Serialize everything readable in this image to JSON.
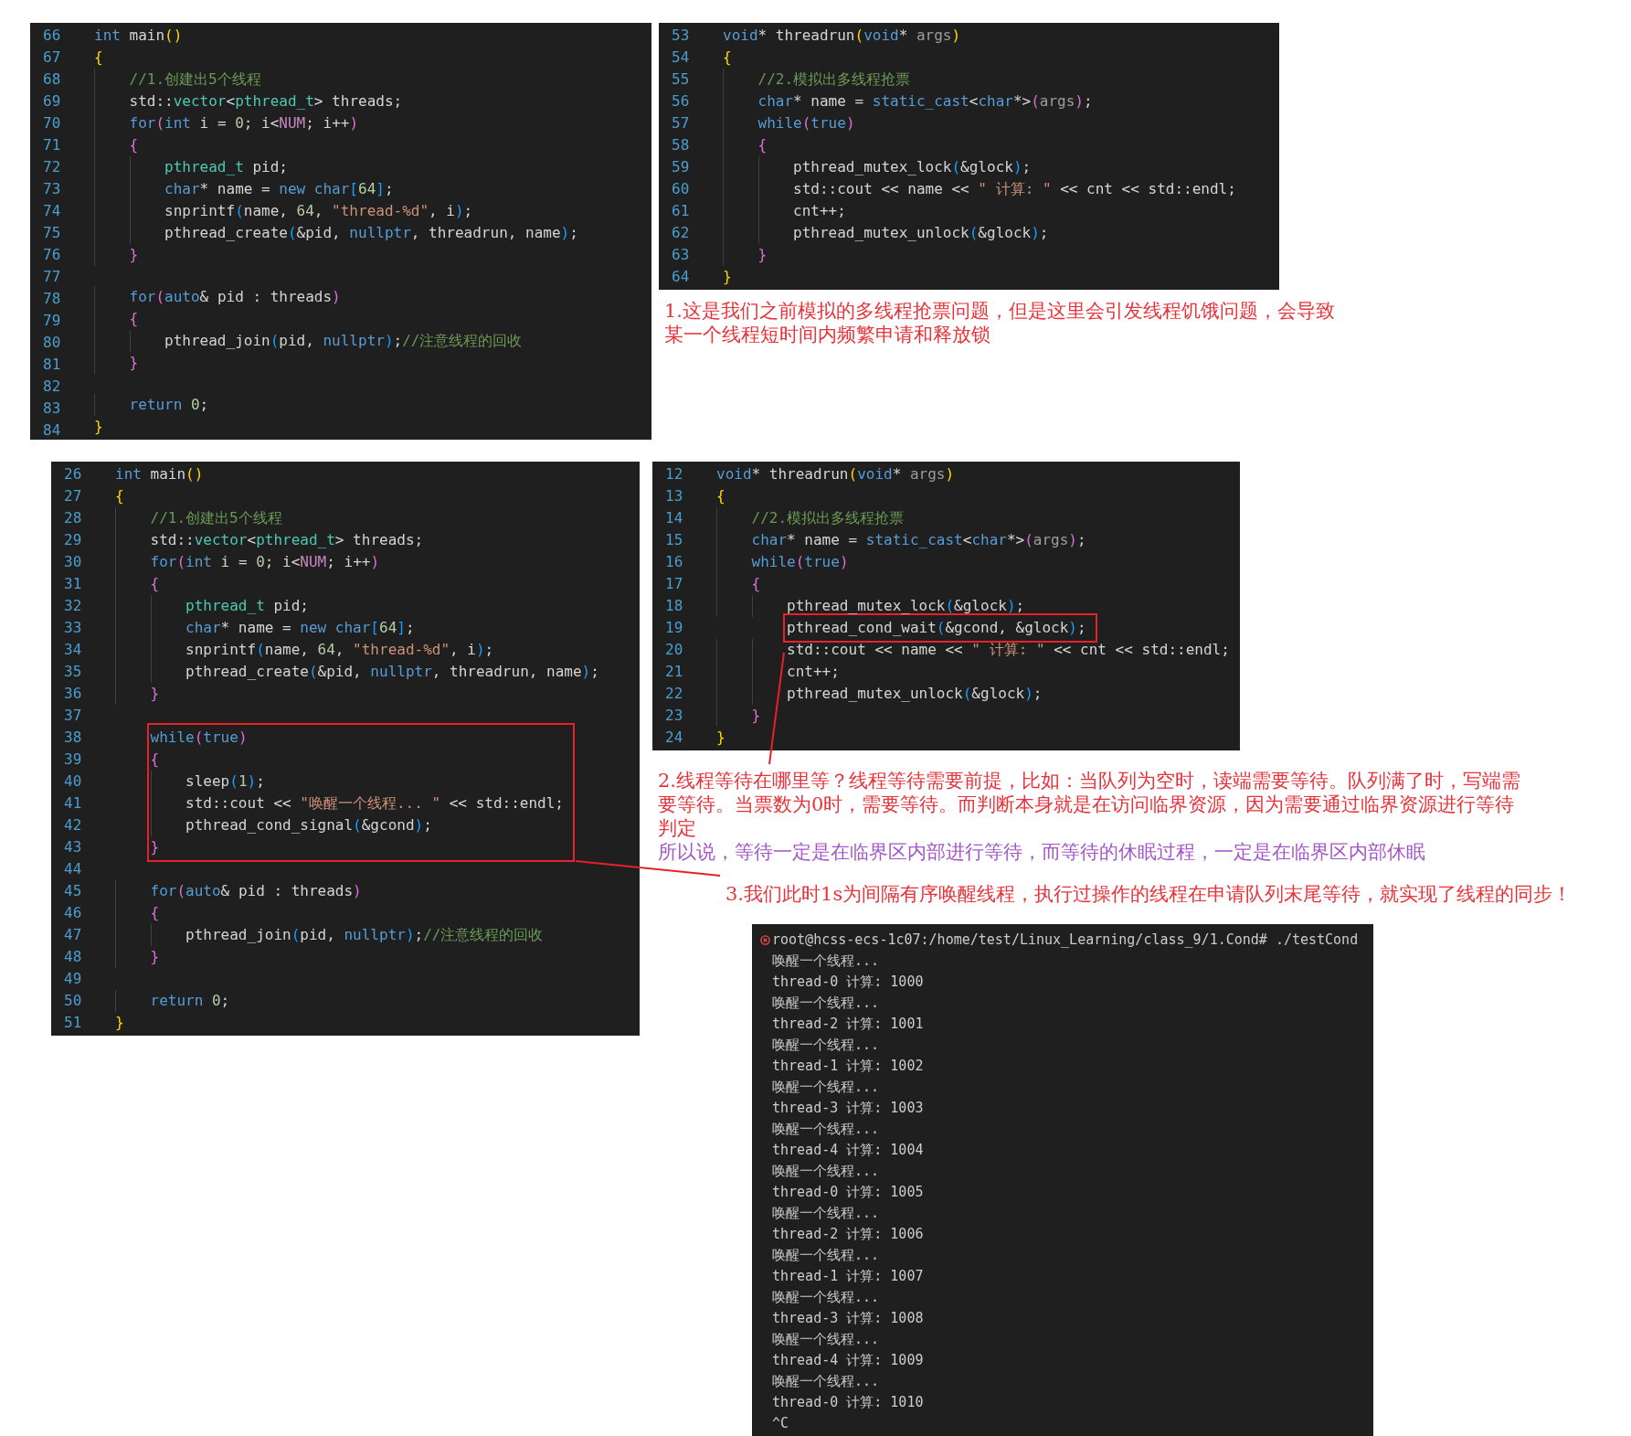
{
  "code_panels": [
    {
      "lines": [
        {
          "kind": "line",
          "number": "66",
          "tokens": [
            {
              "kind": "kw",
              "text": "int"
            },
            {
              "kind": "txt",
              "text": " main"
            },
            {
              "kind": "b1",
              "text": "()"
            }
          ]
        },
        {
          "kind": "line",
          "number": "67",
          "tokens": [
            {
              "kind": "b1",
              "text": "{"
            }
          ]
        },
        {
          "kind": "line",
          "number": "68",
          "tokens": [
            {
              "kind": "com",
              "text": "    //1.创建出5个线程"
            }
          ]
        },
        {
          "kind": "line",
          "number": "69",
          "tokens": [
            {
              "kind": "txt",
              "text": "    std::"
            },
            {
              "kind": "type",
              "text": "vector"
            },
            {
              "kind": "txt",
              "text": "<"
            },
            {
              "kind": "type",
              "text": "pthread_t"
            },
            {
              "kind": "txt",
              "text": "> threads;"
            }
          ]
        },
        {
          "kind": "line",
          "number": "70",
          "tokens": [
            {
              "kind": "kw",
              "text": "    for"
            },
            {
              "kind": "b2",
              "text": "("
            },
            {
              "kind": "kw",
              "text": "int"
            },
            {
              "kind": "txt",
              "text": " i = "
            },
            {
              "kind": "num",
              "text": "0"
            },
            {
              "kind": "txt",
              "text": "; i<"
            },
            {
              "kind": "mac",
              "text": "NUM"
            },
            {
              "kind": "txt",
              "text": "; i++"
            },
            {
              "kind": "b2",
              "text": ")"
            }
          ]
        },
        {
          "kind": "line",
          "number": "71",
          "tokens": [
            {
              "kind": "b2",
              "text": "    {"
            }
          ]
        },
        {
          "kind": "line",
          "number": "72",
          "tokens": [
            {
              "kind": "type",
              "text": "        pthread_t"
            },
            {
              "kind": "txt",
              "text": " pid;"
            }
          ]
        },
        {
          "kind": "line",
          "number": "73",
          "tokens": [
            {
              "kind": "kw",
              "text": "        char"
            },
            {
              "kind": "txt",
              "text": "* name = "
            },
            {
              "kind": "kw",
              "text": "new char"
            },
            {
              "kind": "b3",
              "text": "["
            },
            {
              "kind": "num",
              "text": "64"
            },
            {
              "kind": "b3",
              "text": "]"
            },
            {
              "kind": "txt",
              "text": ";"
            }
          ]
        },
        {
          "kind": "line",
          "number": "74",
          "tokens": [
            {
              "kind": "txt",
              "text": "        snprintf"
            },
            {
              "kind": "b3",
              "text": "("
            },
            {
              "kind": "txt",
              "text": "name, "
            },
            {
              "kind": "num",
              "text": "64"
            },
            {
              "kind": "txt",
              "text": ", "
            },
            {
              "kind": "str",
              "text": "\"thread-%d\""
            },
            {
              "kind": "txt",
              "text": ", i"
            },
            {
              "kind": "b3",
              "text": ")"
            },
            {
              "kind": "txt",
              "text": ";"
            }
          ]
        },
        {
          "kind": "line",
          "number": "75",
          "tokens": [
            {
              "kind": "txt",
              "text": "        pthread_create"
            },
            {
              "kind": "b3",
              "text": "("
            },
            {
              "kind": "txt",
              "text": "&pid, "
            },
            {
              "kind": "kw",
              "text": "nullptr"
            },
            {
              "kind": "txt",
              "text": ", threadrun, name"
            },
            {
              "kind": "b3",
              "text": ")"
            },
            {
              "kind": "txt",
              "text": ";"
            }
          ]
        },
        {
          "kind": "line",
          "number": "76",
          "tokens": [
            {
              "kind": "b2",
              "text": "    }"
            }
          ]
        },
        {
          "kind": "line",
          "number": "77"
        },
        {
          "kind": "line",
          "number": "78",
          "tokens": [
            {
              "kind": "kw",
              "text": "    for"
            },
            {
              "kind": "b2",
              "text": "("
            },
            {
              "kind": "kw",
              "text": "auto"
            },
            {
              "kind": "txt",
              "text": "& pid : threads"
            },
            {
              "kind": "b2",
              "text": ")"
            }
          ]
        },
        {
          "kind": "line",
          "number": "79",
          "tokens": [
            {
              "kind": "b2",
              "text": "    {"
            }
          ]
        },
        {
          "kind": "line",
          "number": "80",
          "tokens": [
            {
              "kind": "txt",
              "text": "        pthread_join"
            },
            {
              "kind": "b3",
              "text": "("
            },
            {
              "kind": "txt",
              "text": "pid, "
            },
            {
              "kind": "kw",
              "text": "nullptr"
            },
            {
              "kind": "b3",
              "text": ")"
            },
            {
              "kind": "txt",
              "text": ";"
            },
            {
              "kind": "com",
              "text": "//注意线程的回收"
            }
          ]
        },
        {
          "kind": "line",
          "number": "81",
          "tokens": [
            {
              "kind": "b2",
              "text": "    }"
            }
          ]
        },
        {
          "kind": "line",
          "number": "82"
        },
        {
          "kind": "line",
          "number": "83",
          "tokens": [
            {
              "kind": "kw",
              "text": "    return"
            },
            {
              "kind": "num",
              "text": " 0"
            },
            {
              "kind": "txt",
              "text": ";"
            }
          ]
        },
        {
          "kind": "line",
          "number": "84",
          "tokens": [
            {
              "kind": "b1",
              "text": "}"
            }
          ]
        }
      ]
    },
    {
      "lines": [
        {
          "kind": "line",
          "number": "53",
          "tokens": [
            {
              "kind": "kw",
              "text": "void"
            },
            {
              "kind": "txt",
              "text": "* threadrun"
            },
            {
              "kind": "b1",
              "text": "("
            },
            {
              "kind": "kw",
              "text": "void"
            },
            {
              "kind": "txt",
              "text": "* "
            },
            {
              "kind": "par",
              "text": "args"
            },
            {
              "kind": "b1",
              "text": ")"
            }
          ]
        },
        {
          "kind": "line",
          "number": "54",
          "tokens": [
            {
              "kind": "b1",
              "text": "{"
            }
          ]
        },
        {
          "kind": "line",
          "number": "55",
          "tokens": [
            {
              "kind": "com",
              "text": "    //2.模拟出多线程抢票"
            }
          ]
        },
        {
          "kind": "line",
          "number": "56",
          "tokens": [
            {
              "kind": "kw",
              "text": "    char"
            },
            {
              "kind": "txt",
              "text": "* name = "
            },
            {
              "kind": "kw",
              "text": "static_cast"
            },
            {
              "kind": "txt",
              "text": "<"
            },
            {
              "kind": "kw",
              "text": "char"
            },
            {
              "kind": "txt",
              "text": "*>"
            },
            {
              "kind": "b2",
              "text": "("
            },
            {
              "kind": "par",
              "text": "args"
            },
            {
              "kind": "b2",
              "text": ")"
            },
            {
              "kind": "txt",
              "text": ";"
            }
          ]
        },
        {
          "kind": "line",
          "number": "57",
          "tokens": [
            {
              "kind": "kw",
              "text": "    while"
            },
            {
              "kind": "b2",
              "text": "("
            },
            {
              "kind": "kw",
              "text": "true"
            },
            {
              "kind": "b2",
              "text": ")"
            }
          ]
        },
        {
          "kind": "line",
          "number": "58",
          "tokens": [
            {
              "kind": "b2",
              "text": "    {"
            }
          ]
        },
        {
          "kind": "line",
          "number": "59",
          "tokens": [
            {
              "kind": "txt",
              "text": "        pthread_mutex_lock"
            },
            {
              "kind": "b3",
              "text": "("
            },
            {
              "kind": "txt",
              "text": "&glock"
            },
            {
              "kind": "b3",
              "text": ")"
            },
            {
              "kind": "txt",
              "text": ";"
            }
          ]
        },
        {
          "kind": "line",
          "number": "60",
          "tokens": [
            {
              "kind": "txt",
              "text": "        std::cout << name << "
            },
            {
              "kind": "str",
              "text": "\" 计算: \""
            },
            {
              "kind": "txt",
              "text": " << cnt << std::endl;"
            }
          ]
        },
        {
          "kind": "line",
          "number": "61",
          "tokens": [
            {
              "kind": "txt",
              "text": "        cnt++;"
            }
          ]
        },
        {
          "kind": "line",
          "number": "62",
          "tokens": [
            {
              "kind": "txt",
              "text": "        pthread_mutex_unlock"
            },
            {
              "kind": "b3",
              "text": "("
            },
            {
              "kind": "txt",
              "text": "&glock"
            },
            {
              "kind": "b3",
              "text": ")"
            },
            {
              "kind": "txt",
              "text": ";"
            }
          ]
        },
        {
          "kind": "line",
          "number": "63",
          "tokens": [
            {
              "kind": "b2",
              "text": "    }"
            }
          ]
        },
        {
          "kind": "line",
          "number": "64",
          "tokens": [
            {
              "kind": "b1",
              "text": "}"
            }
          ]
        }
      ]
    },
    {
      "lines": [
        {
          "kind": "line",
          "number": "26",
          "tokens": [
            {
              "kind": "kw",
              "text": "int"
            },
            {
              "kind": "txt",
              "text": " main"
            },
            {
              "kind": "b1",
              "text": "()"
            }
          ]
        },
        {
          "kind": "line",
          "number": "27",
          "tokens": [
            {
              "kind": "b1",
              "text": "{"
            }
          ]
        },
        {
          "kind": "line",
          "number": "28",
          "tokens": [
            {
              "kind": "com",
              "text": "    //1.创建出5个线程"
            }
          ]
        },
        {
          "kind": "line",
          "number": "29",
          "tokens": [
            {
              "kind": "txt",
              "text": "    std::"
            },
            {
              "kind": "type",
              "text": "vector"
            },
            {
              "kind": "txt",
              "text": "<"
            },
            {
              "kind": "type",
              "text": "pthread_t"
            },
            {
              "kind": "txt",
              "text": "> threads;"
            }
          ]
        },
        {
          "kind": "line",
          "number": "30",
          "tokens": [
            {
              "kind": "kw",
              "text": "    for"
            },
            {
              "kind": "b2",
              "text": "("
            },
            {
              "kind": "kw",
              "text": "int"
            },
            {
              "kind": "txt",
              "text": " i = "
            },
            {
              "kind": "num",
              "text": "0"
            },
            {
              "kind": "txt",
              "text": "; i<"
            },
            {
              "kind": "mac",
              "text": "NUM"
            },
            {
              "kind": "txt",
              "text": "; i++"
            },
            {
              "kind": "b2",
              "text": ")"
            }
          ]
        },
        {
          "kind": "line",
          "number": "31",
          "tokens": [
            {
              "kind": "b2",
              "text": "    {"
            }
          ]
        },
        {
          "kind": "line",
          "number": "32",
          "tokens": [
            {
              "kind": "type",
              "text": "        pthread_t"
            },
            {
              "kind": "txt",
              "text": " pid;"
            }
          ]
        },
        {
          "kind": "line",
          "number": "33",
          "tokens": [
            {
              "kind": "kw",
              "text": "        char"
            },
            {
              "kind": "txt",
              "text": "* name = "
            },
            {
              "kind": "kw",
              "text": "new char"
            },
            {
              "kind": "b3",
              "text": "["
            },
            {
              "kind": "num",
              "text": "64"
            },
            {
              "kind": "b3",
              "text": "]"
            },
            {
              "kind": "txt",
              "text": ";"
            }
          ]
        },
        {
          "kind": "line",
          "number": "34",
          "tokens": [
            {
              "kind": "txt",
              "text": "        snprintf"
            },
            {
              "kind": "b3",
              "text": "("
            },
            {
              "kind": "txt",
              "text": "name, "
            },
            {
              "kind": "num",
              "text": "64"
            },
            {
              "kind": "txt",
              "text": ", "
            },
            {
              "kind": "str",
              "text": "\"thread-%d\""
            },
            {
              "kind": "txt",
              "text": ", i"
            },
            {
              "kind": "b3",
              "text": ")"
            },
            {
              "kind": "txt",
              "text": ";"
            }
          ]
        },
        {
          "kind": "line",
          "number": "35",
          "tokens": [
            {
              "kind": "txt",
              "text": "        pthread_create"
            },
            {
              "kind": "b3",
              "text": "("
            },
            {
              "kind": "txt",
              "text": "&pid, "
            },
            {
              "kind": "kw",
              "text": "nullptr"
            },
            {
              "kind": "txt",
              "text": ", threadrun, name"
            },
            {
              "kind": "b3",
              "text": ")"
            },
            {
              "kind": "txt",
              "text": ";"
            }
          ]
        },
        {
          "kind": "line",
          "number": "36",
          "tokens": [
            {
              "kind": "b2",
              "text": "    }"
            }
          ]
        },
        {
          "kind": "line",
          "number": "37"
        },
        {
          "kind": "highlight",
          "lines": [
            {
              "kind": "line",
              "number": "38",
              "tokens": [
                {
                  "kind": "kw",
                  "text": "    while"
                },
                {
                  "kind": "b2",
                  "text": "("
                },
                {
                  "kind": "kw",
                  "text": "true"
                },
                {
                  "kind": "b2",
                  "text": ")"
                }
              ]
            },
            {
              "kind": "line",
              "number": "39",
              "tokens": [
                {
                  "kind": "b2",
                  "text": "    {"
                }
              ]
            },
            {
              "kind": "line",
              "number": "40",
              "tokens": [
                {
                  "kind": "txt",
                  "text": "        sleep"
                },
                {
                  "kind": "b3",
                  "text": "("
                },
                {
                  "kind": "num",
                  "text": "1"
                },
                {
                  "kind": "b3",
                  "text": ")"
                },
                {
                  "kind": "txt",
                  "text": ";"
                }
              ]
            },
            {
              "kind": "line",
              "number": "41",
              "tokens": [
                {
                  "kind": "txt",
                  "text": "        std::cout << "
                },
                {
                  "kind": "str",
                  "text": "\"唤醒一个线程... \""
                },
                {
                  "kind": "txt",
                  "text": " << std::endl;"
                }
              ]
            },
            {
              "kind": "line",
              "number": "42",
              "tokens": [
                {
                  "kind": "txt",
                  "text": "        pthread_cond_signal"
                },
                {
                  "kind": "b3",
                  "text": "("
                },
                {
                  "kind": "txt",
                  "text": "&gcond"
                },
                {
                  "kind": "b3",
                  "text": ")"
                },
                {
                  "kind": "txt",
                  "text": ";"
                }
              ]
            },
            {
              "kind": "line",
              "number": "43",
              "tokens": [
                {
                  "kind": "b2",
                  "text": "    }"
                }
              ]
            }
          ]
        },
        {
          "kind": "line",
          "number": "44"
        },
        {
          "kind": "line",
          "number": "45",
          "tokens": [
            {
              "kind": "kw",
              "text": "    for"
            },
            {
              "kind": "b2",
              "text": "("
            },
            {
              "kind": "kw",
              "text": "auto"
            },
            {
              "kind": "txt",
              "text": "& pid : threads"
            },
            {
              "kind": "b2",
              "text": ")"
            }
          ]
        },
        {
          "kind": "line",
          "number": "46",
          "tokens": [
            {
              "kind": "b2",
              "text": "    {"
            }
          ]
        },
        {
          "kind": "line",
          "number": "47",
          "tokens": [
            {
              "kind": "txt",
              "text": "        pthread_join"
            },
            {
              "kind": "b3",
              "text": "("
            },
            {
              "kind": "txt",
              "text": "pid, "
            },
            {
              "kind": "kw",
              "text": "nullptr"
            },
            {
              "kind": "b3",
              "text": ")"
            },
            {
              "kind": "txt",
              "text": ";"
            },
            {
              "kind": "com",
              "text": "//注意线程的回收"
            }
          ]
        },
        {
          "kind": "line",
          "number": "48",
          "tokens": [
            {
              "kind": "b2",
              "text": "    }"
            }
          ]
        },
        {
          "kind": "line",
          "number": "49"
        },
        {
          "kind": "line",
          "number": "50",
          "tokens": [
            {
              "kind": "kw",
              "text": "    return"
            },
            {
              "kind": "num",
              "text": " 0"
            },
            {
              "kind": "txt",
              "text": ";"
            }
          ]
        },
        {
          "kind": "line",
          "number": "51",
          "tokens": [
            {
              "kind": "b1",
              "text": "}"
            }
          ]
        }
      ]
    },
    {
      "lines": [
        {
          "kind": "line",
          "number": "12",
          "tokens": [
            {
              "kind": "kw",
              "text": "void"
            },
            {
              "kind": "txt",
              "text": "* threadrun"
            },
            {
              "kind": "b1",
              "text": "("
            },
            {
              "kind": "kw",
              "text": "void"
            },
            {
              "kind": "txt",
              "text": "* "
            },
            {
              "kind": "par",
              "text": "args"
            },
            {
              "kind": "b1",
              "text": ")"
            }
          ]
        },
        {
          "kind": "line",
          "number": "13",
          "tokens": [
            {
              "kind": "b1",
              "text": "{"
            }
          ]
        },
        {
          "kind": "line",
          "number": "14",
          "tokens": [
            {
              "kind": "com",
              "text": "    //2.模拟出多线程抢票"
            }
          ]
        },
        {
          "kind": "line",
          "number": "15",
          "tokens": [
            {
              "kind": "kw",
              "text": "    char"
            },
            {
              "kind": "txt",
              "text": "* name = "
            },
            {
              "kind": "kw",
              "text": "static_cast"
            },
            {
              "kind": "txt",
              "text": "<"
            },
            {
              "kind": "kw",
              "text": "char"
            },
            {
              "kind": "txt",
              "text": "*>"
            },
            {
              "kind": "b2",
              "text": "("
            },
            {
              "kind": "par",
              "text": "args"
            },
            {
              "kind": "b2",
              "text": ")"
            },
            {
              "kind": "txt",
              "text": ";"
            }
          ]
        },
        {
          "kind": "line",
          "number": "16",
          "tokens": [
            {
              "kind": "kw",
              "text": "    while"
            },
            {
              "kind": "b2",
              "text": "("
            },
            {
              "kind": "kw",
              "text": "true"
            },
            {
              "kind": "b2",
              "text": ")"
            }
          ]
        },
        {
          "kind": "line",
          "number": "17",
          "tokens": [
            {
              "kind": "b2",
              "text": "    {"
            }
          ]
        },
        {
          "kind": "line",
          "number": "18",
          "tokens": [
            {
              "kind": "txt",
              "text": "        pthread_mutex_lock"
            },
            {
              "kind": "b3",
              "text": "("
            },
            {
              "kind": "txt",
              "text": "&glock"
            },
            {
              "kind": "b3",
              "text": ")"
            },
            {
              "kind": "txt",
              "text": ";"
            }
          ]
        },
        {
          "kind": "highlight",
          "lines": [
            {
              "kind": "line",
              "number": "19",
              "tokens": [
                {
                  "kind": "txt",
                  "text": "        pthread_cond_wait"
                },
                {
                  "kind": "b3",
                  "text": "("
                },
                {
                  "kind": "txt",
                  "text": "&gcond, &glock"
                },
                {
                  "kind": "b3",
                  "text": ")"
                },
                {
                  "kind": "txt",
                  "text": ";"
                }
              ]
            }
          ]
        },
        {
          "kind": "line",
          "number": "20",
          "tokens": [
            {
              "kind": "txt",
              "text": "        std::cout << name << "
            },
            {
              "kind": "str",
              "text": "\" 计算: \""
            },
            {
              "kind": "txt",
              "text": " << cnt << std::endl;"
            }
          ]
        },
        {
          "kind": "line",
          "number": "21",
          "tokens": [
            {
              "kind": "txt",
              "text": "        cnt++;"
            }
          ]
        },
        {
          "kind": "line",
          "number": "22",
          "tokens": [
            {
              "kind": "txt",
              "text": "        pthread_mutex_unlock"
            },
            {
              "kind": "b3",
              "text": "("
            },
            {
              "kind": "txt",
              "text": "&glock"
            },
            {
              "kind": "b3",
              "text": ")"
            },
            {
              "kind": "txt",
              "text": ";"
            }
          ]
        },
        {
          "kind": "line",
          "number": "23",
          "tokens": [
            {
              "kind": "b2",
              "text": "    }"
            }
          ]
        },
        {
          "kind": "line",
          "number": "24",
          "tokens": [
            {
              "kind": "b1",
              "text": "}"
            }
          ]
        }
      ]
    }
  ],
  "notes": [
    {
      "text": "1.这是我们之前模拟的多线程抢票问题，但是这里会引发线程饥饿问题，会导致某一个线程短时间内频繁申请和释放锁",
      "color": "#e8323a"
    },
    {
      "text": "2.线程等待在哪里等？线程等待需要前提，比如：当队列为空时，读端需要等待。队列满了时，写端需要等待。当票数为0时，需要等待。而判断本身就是在访问临界资源，因为需要通过临界资源进行等待判定",
      "color": "#e8323a"
    },
    {
      "text": "所以说，等待一定是在临界区内部进行等待，而等待的休眠过程，一定是在临界区内部休眠",
      "color": "#a356c8"
    },
    {
      "text": "3.我们此时1s为间隔有序唤醒线程，执行过操作的线程在申请队列末尾等待，就实现了线程的同步！",
      "color": "#e8323a"
    }
  ],
  "terminal": {
    "lines": [
      {
        "kind": "command",
        "text": "root@hcss-ecs-1c07:/home/test/Linux_Learning/class_9/1.Cond# ./testCond"
      },
      {
        "kind": "output",
        "text": "唤醒一个线程..."
      },
      {
        "kind": "output",
        "text": "thread-0 计算: 1000"
      },
      {
        "kind": "output",
        "text": "唤醒一个线程..."
      },
      {
        "kind": "output",
        "text": "thread-2 计算: 1001"
      },
      {
        "kind": "output",
        "text": "唤醒一个线程..."
      },
      {
        "kind": "output",
        "text": "thread-1 计算: 1002"
      },
      {
        "kind": "output",
        "text": "唤醒一个线程..."
      },
      {
        "kind": "output",
        "text": "thread-3 计算: 1003"
      },
      {
        "kind": "output",
        "text": "唤醒一个线程..."
      },
      {
        "kind": "output",
        "text": "thread-4 计算: 1004"
      },
      {
        "kind": "output",
        "text": "唤醒一个线程..."
      },
      {
        "kind": "output",
        "text": "thread-0 计算: 1005"
      },
      {
        "kind": "output",
        "text": "唤醒一个线程..."
      },
      {
        "kind": "output",
        "text": "thread-2 计算: 1006"
      },
      {
        "kind": "output",
        "text": "唤醒一个线程..."
      },
      {
        "kind": "output",
        "text": "thread-1 计算: 1007"
      },
      {
        "kind": "output",
        "text": "唤醒一个线程..."
      },
      {
        "kind": "output",
        "text": "thread-3 计算: 1008"
      },
      {
        "kind": "output",
        "text": "唤醒一个线程..."
      },
      {
        "kind": "output",
        "text": "thread-4 计算: 1009"
      },
      {
        "kind": "output",
        "text": "唤醒一个线程..."
      },
      {
        "kind": "output",
        "text": "thread-0 计算: 1010"
      },
      {
        "kind": "output",
        "text": "^C"
      }
    ]
  }
}
